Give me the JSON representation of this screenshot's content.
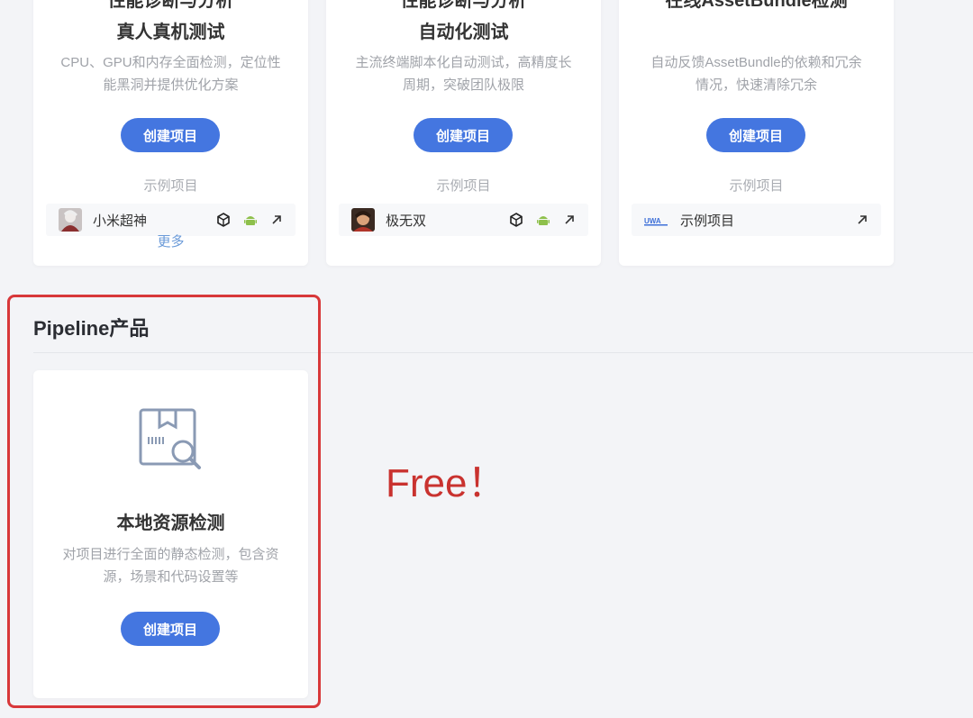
{
  "cards": [
    {
      "subtitle_line1": "性能诊断与分析",
      "subtitle_line2": "真人真机测试",
      "description": "CPU、GPU和内存全面检测，定位性能黑洞并提供优化方案",
      "button_label": "创建项目",
      "example_label": "示例项目",
      "example": {
        "name": "小米超神",
        "avatar": "game-avatar-icon"
      },
      "platform_icons": [
        "unity-icon",
        "android-icon",
        "external-link-icon"
      ],
      "more_label": "更多"
    },
    {
      "subtitle_line1": "性能诊断与分析",
      "subtitle_line2": "自动化测试",
      "description": "主流终端脚本化自动测试，高精度长周期，突破团队极限",
      "button_label": "创建项目",
      "example_label": "示例项目",
      "example": {
        "name": "极无双",
        "avatar": "game-avatar-icon"
      },
      "platform_icons": [
        "unity-icon",
        "android-icon",
        "external-link-icon"
      ]
    },
    {
      "subtitle_line1": "在线AssetBundle检测",
      "description": "自动反馈AssetBundle的依赖和冗余情况，快速清除冗余",
      "button_label": "创建项目",
      "example_label": "示例项目",
      "example": {
        "name": "示例项目",
        "avatar": "uwa-logo"
      },
      "platform_icons": [
        "external-link-icon"
      ]
    }
  ],
  "pipeline_section": {
    "title": "Pipeline产品",
    "card": {
      "icon": "package-search-icon",
      "title": "本地资源检测",
      "description": "对项目进行全面的静态检测，包含资源，场景和代码设置等",
      "button_label": "创建项目"
    }
  },
  "annotation": {
    "text": "Free！",
    "color": "#c9322f",
    "box_color": "#d8383a"
  },
  "colors": {
    "accent": "#4476e0",
    "background": "#f3f4f7",
    "link": "#6a9ad8"
  }
}
